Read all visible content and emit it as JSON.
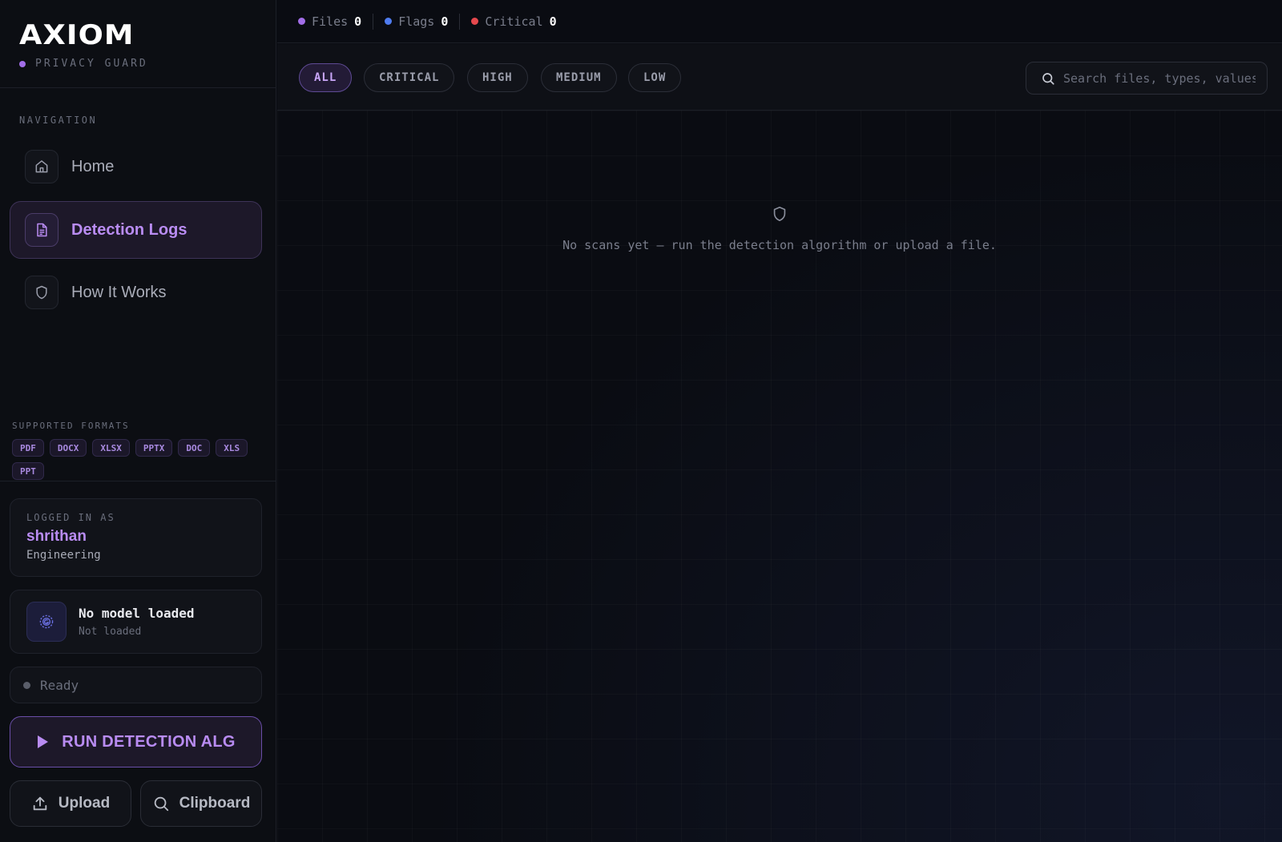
{
  "brand": {
    "name": "AXIOM",
    "tagline": "PRIVACY GUARD"
  },
  "sidebar": {
    "nav_heading": "NAVIGATION",
    "items": [
      {
        "label": "Home",
        "icon": "home-icon",
        "active": false
      },
      {
        "label": "Detection Logs",
        "icon": "document-icon",
        "active": true
      },
      {
        "label": "How It Works",
        "icon": "shield-icon",
        "active": false
      }
    ],
    "formats_heading": "SUPPORTED FORMATS",
    "formats": [
      "PDF",
      "DOCX",
      "XLSX",
      "PPTX",
      "DOC",
      "XLS",
      "PPT"
    ],
    "user": {
      "caption": "LOGGED IN AS",
      "name": "shrithan",
      "department": "Engineering"
    },
    "model": {
      "title": "No model loaded",
      "subtitle": "Not loaded"
    },
    "status": "Ready",
    "run_button": "RUN DETECTION ALG",
    "upload_button": "Upload",
    "clipboard_button": "Clipboard"
  },
  "topbar": {
    "stats": [
      {
        "label": "Files",
        "value": "0",
        "color": "#a26ee8"
      },
      {
        "label": "Flags",
        "value": "0",
        "color": "#4f7cf0"
      },
      {
        "label": "Critical",
        "value": "0",
        "color": "#e5484d"
      }
    ]
  },
  "filters": {
    "chips": [
      "ALL",
      "CRITICAL",
      "HIGH",
      "MEDIUM",
      "LOW"
    ],
    "selected": "ALL",
    "search_placeholder": "Search files, types, values..."
  },
  "main": {
    "empty_message": "No scans yet — run the detection algorithm or upload a file."
  },
  "colors": {
    "accent": "#b98cf2",
    "background": "#0a0c12"
  }
}
